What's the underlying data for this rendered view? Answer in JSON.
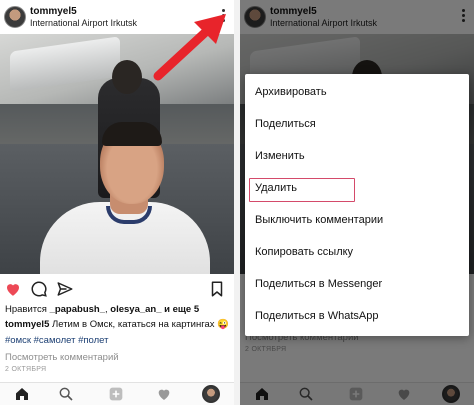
{
  "post": {
    "username": "tommyel5",
    "location": "International Airport Irkutsk",
    "likes_prefix": "Нравится",
    "liker_1": "_papabush_",
    "liker_2": "olesya_an_",
    "likes_suffix": "и еще 5",
    "caption_user": "tommyel5",
    "caption_text": "Летим в Омск, кататься на картингах 😜",
    "tags": "#омск #самолет #полет",
    "comment_placeholder": "Посмотреть комментарий",
    "date": "2 ОКТЯБРЯ"
  },
  "icons": {
    "like": "heart-icon",
    "comment": "comment-icon",
    "share": "send-icon",
    "save": "bookmark-icon",
    "more": "more-vertical-icon",
    "home": "home-icon",
    "search": "search-icon",
    "add": "add-post-icon",
    "activity": "heart-outline-icon",
    "profile": "profile-avatar"
  },
  "colors": {
    "like_red": "#ed4956",
    "tag_blue": "#1c3f73",
    "arrow_red": "#e8242b",
    "highlight": "#d44a6a"
  },
  "menu": {
    "items": [
      "Архивировать",
      "Поделиться",
      "Изменить",
      "Удалить",
      "Выключить комментарии",
      "Копировать ссылку",
      "Поделиться в Messenger",
      "Поделиться в WhatsApp"
    ],
    "highlighted_index": 3
  }
}
